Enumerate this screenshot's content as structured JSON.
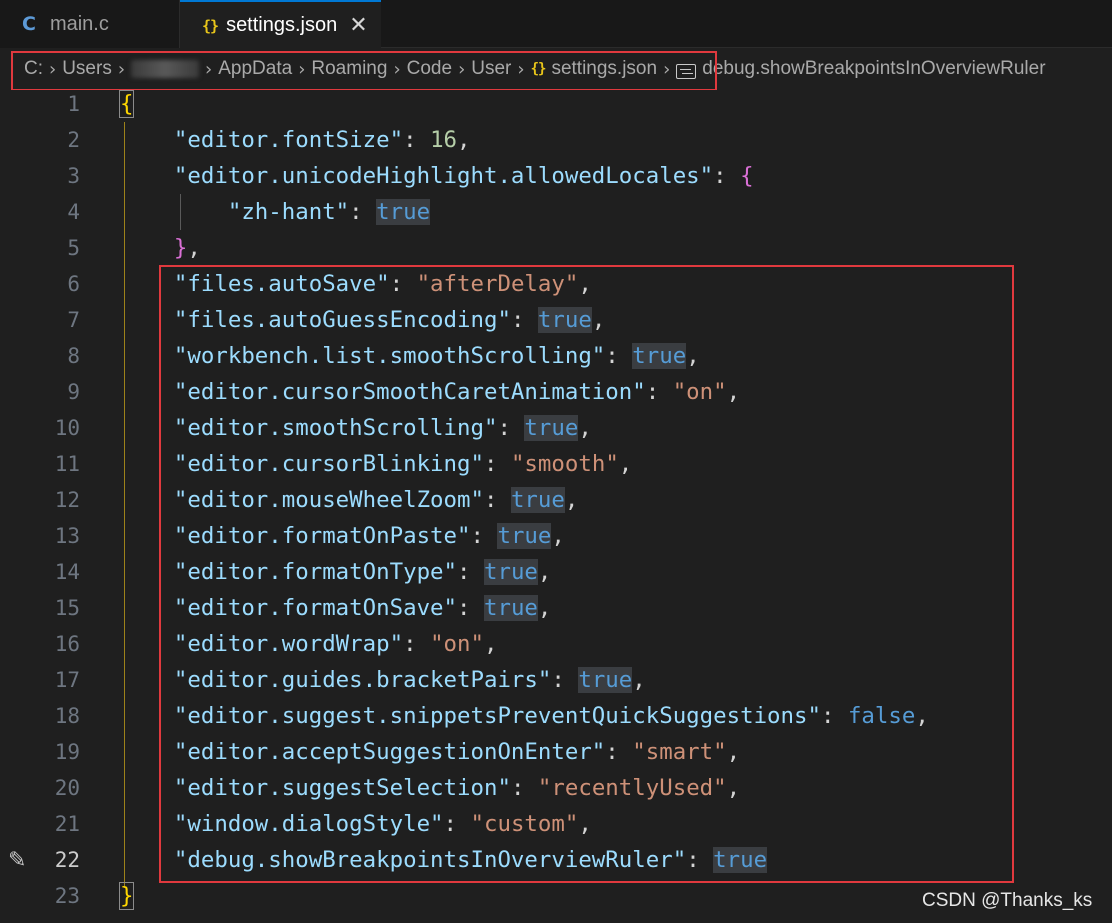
{
  "tabs": [
    {
      "icon": "C",
      "label": "main.c"
    },
    {
      "icon": "{}",
      "label": "settings.json",
      "close": "✕"
    }
  ],
  "breadcrumb": {
    "items": [
      "C:",
      "Users",
      "AppData",
      "Roaming",
      "Code",
      "User",
      "settings.json"
    ],
    "json_icon": "{}",
    "symbol": "debug.showBreakpointsInOverviewRuler"
  },
  "editor": {
    "active_line": 22,
    "lines": [
      {
        "n": "1"
      },
      {
        "n": "2"
      },
      {
        "n": "3"
      },
      {
        "n": "4"
      },
      {
        "n": "5"
      },
      {
        "n": "6"
      },
      {
        "n": "7"
      },
      {
        "n": "8"
      },
      {
        "n": "9"
      },
      {
        "n": "10"
      },
      {
        "n": "11"
      },
      {
        "n": "12"
      },
      {
        "n": "13"
      },
      {
        "n": "14"
      },
      {
        "n": "15"
      },
      {
        "n": "16"
      },
      {
        "n": "17"
      },
      {
        "n": "18"
      },
      {
        "n": "19"
      },
      {
        "n": "20"
      },
      {
        "n": "21"
      },
      {
        "n": "22"
      },
      {
        "n": "23"
      }
    ],
    "settings": {
      "font_size_key": "\"editor.fontSize\"",
      "font_size_val": "16",
      "unicode_key": "\"editor.unicodeHighlight.allowedLocales\"",
      "locale_key": "\"zh-hant\"",
      "autosave_key": "\"files.autoSave\"",
      "autosave_val": "\"afterDelay\"",
      "guess_key": "\"files.autoGuessEncoding\"",
      "wb_smooth_key": "\"workbench.list.smoothScrolling\"",
      "caret_key": "\"editor.cursorSmoothCaretAnimation\"",
      "caret_val": "\"on\"",
      "smooth_key": "\"editor.smoothScrolling\"",
      "blink_key": "\"editor.cursorBlinking\"",
      "blink_val": "\"smooth\"",
      "zoom_key": "\"editor.mouseWheelZoom\"",
      "paste_key": "\"editor.formatOnPaste\"",
      "type_key": "\"editor.formatOnType\"",
      "save_key": "\"editor.formatOnSave\"",
      "wrap_key": "\"editor.wordWrap\"",
      "wrap_val": "\"on\"",
      "guides_key": "\"editor.guides.bracketPairs\"",
      "snippets_key": "\"editor.suggest.snippetsPreventQuickSuggestions\"",
      "snippets_val": "false",
      "accept_key": "\"editor.acceptSuggestionOnEnter\"",
      "accept_val": "\"smart\"",
      "selection_key": "\"editor.suggestSelection\"",
      "selection_val": "\"recentlyUsed\"",
      "dialog_key": "\"window.dialogStyle\"",
      "dialog_val": "\"custom\"",
      "debug_key": "\"debug.showBreakpointsInOverviewRuler\"",
      "true_val": "true"
    },
    "punct": {
      "open_brace": "{",
      "close_brace": "}",
      "close_brace_comma": "}",
      "comma": ",",
      "colon": ": "
    }
  },
  "watermark": "CSDN @Thanks_ks",
  "colors": {
    "background": "#1f1f1f",
    "key": "#9cdcfe",
    "string": "#ce9178",
    "number": "#b5cea8",
    "boolean": "#569cd6",
    "highlight_box": "#e0393e"
  }
}
